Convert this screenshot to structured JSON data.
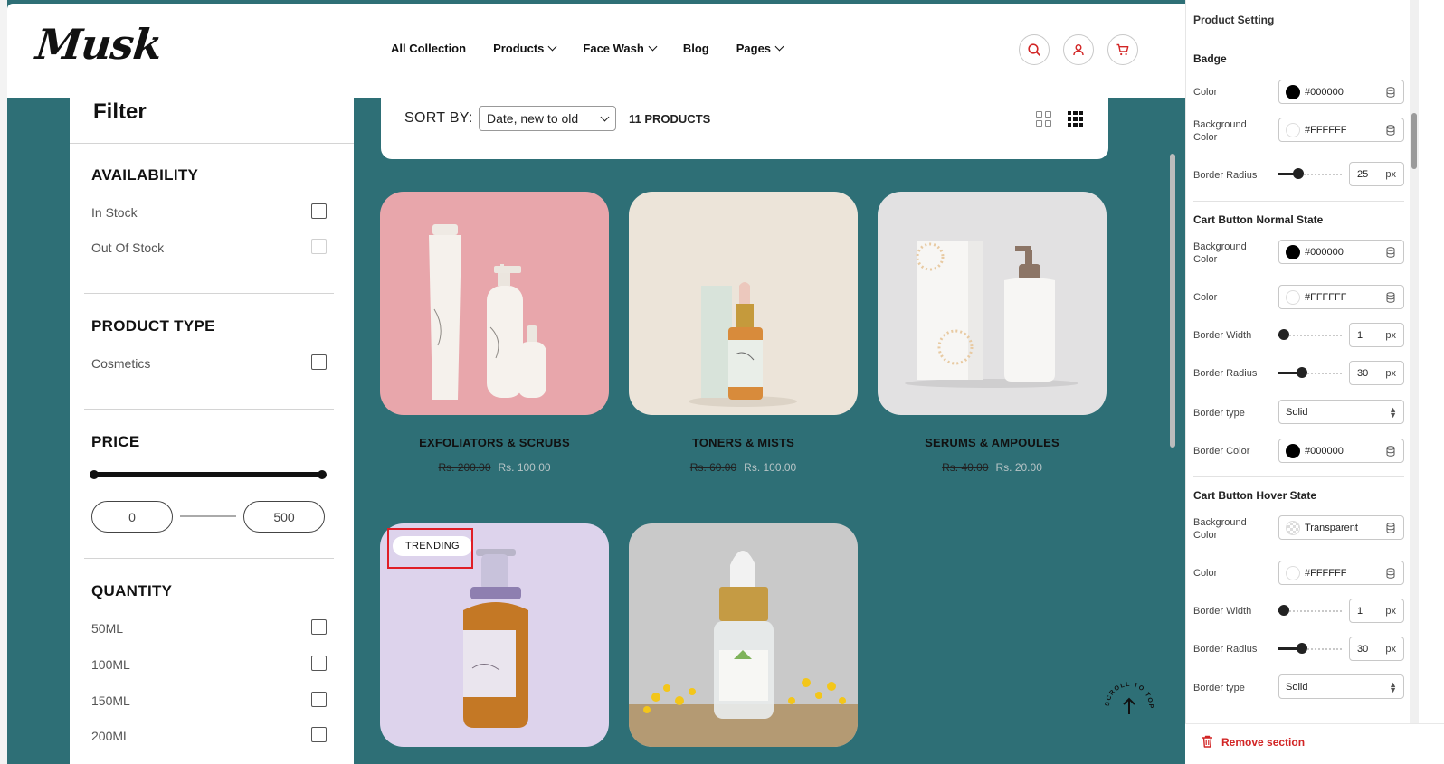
{
  "store": {
    "logo": "Musk",
    "nav": [
      "All Collection",
      "Products",
      "Face Wash",
      "Blog",
      "Pages"
    ],
    "nav_dropdown": [
      false,
      true,
      true,
      false,
      true
    ],
    "header_icons": [
      "search-icon",
      "user-icon",
      "cart-icon"
    ]
  },
  "filter": {
    "title": "Filter",
    "availability": {
      "title": "AVAILABILITY",
      "options": [
        "In Stock",
        "Out Of Stock"
      ]
    },
    "product_type": {
      "title": "PRODUCT TYPE",
      "options": [
        "Cosmetics"
      ]
    },
    "price": {
      "title": "PRICE",
      "min": "0",
      "max": "500"
    },
    "quantity": {
      "title": "QUANTITY",
      "options": [
        "50ML",
        "100ML",
        "150ML",
        "200ML"
      ]
    }
  },
  "toolbar": {
    "sort_label": "SORT BY:",
    "sort_value": "Date, new to old",
    "count": "11 PRODUCTS"
  },
  "products": [
    {
      "title": "EXFOLIATORS & SCRUBS",
      "old_price": "Rs. 200.00",
      "new_price": "Rs. 100.00",
      "badge": ""
    },
    {
      "title": "TONERS & MISTS",
      "old_price": "Rs. 60.00",
      "new_price": "Rs. 100.00",
      "badge": ""
    },
    {
      "title": "SERUMS & AMPOULES",
      "old_price": "Rs. 40.00",
      "new_price": "Rs. 20.00",
      "badge": ""
    },
    {
      "title": "",
      "old_price": "",
      "new_price": "",
      "badge": "TRENDING"
    },
    {
      "title": "",
      "old_price": "",
      "new_price": "",
      "badge": ""
    }
  ],
  "scroll_to_top": "SCROLL TO TOP",
  "panel": {
    "title": "Product Setting",
    "badge": {
      "title": "Badge",
      "color_label": "Color",
      "color_value": "#000000",
      "bg_label": "Background Color",
      "bg_value": "#FFFFFF",
      "radius_label": "Border Radius",
      "radius_value": "25",
      "unit": "px"
    },
    "cart_normal": {
      "title": "Cart Button Normal State",
      "bg_label": "Background Color",
      "bg_value": "#000000",
      "color_label": "Color",
      "color_value": "#FFFFFF",
      "width_label": "Border Width",
      "width_value": "1",
      "radius_label": "Border Radius",
      "radius_value": "30",
      "type_label": "Border type",
      "type_value": "Solid",
      "border_color_label": "Border Color",
      "border_color_value": "#000000",
      "unit": "px"
    },
    "cart_hover": {
      "title": "Cart Button Hover State",
      "bg_label": "Background Color",
      "bg_value": "Transparent",
      "color_label": "Color",
      "color_value": "#FFFFFF",
      "width_label": "Border Width",
      "width_value": "1",
      "radius_label": "Border Radius",
      "radius_value": "30",
      "type_label": "Border type",
      "type_value": "Solid",
      "unit": "px"
    },
    "remove_label": "Remove section"
  },
  "colors": {
    "canvas_bg": "#2e6f76",
    "highlight": "#e01e26",
    "remove": "#d22525"
  }
}
